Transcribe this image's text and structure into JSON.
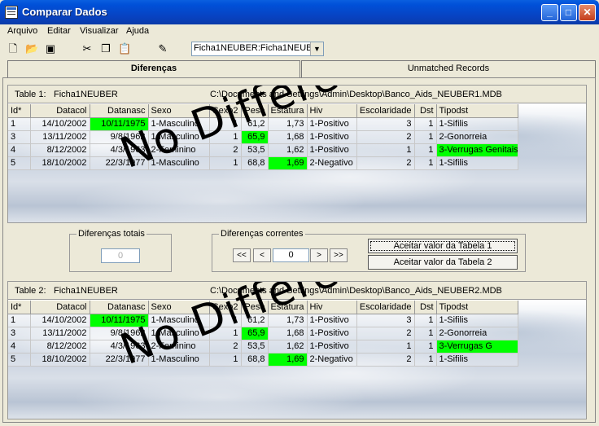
{
  "window": {
    "title": "Comparar Dados"
  },
  "menu": [
    "Arquivo",
    "Editar",
    "Visualizar",
    "Ajuda"
  ],
  "toolbar": {
    "icons": [
      "new-file-icon",
      "open-folder-icon",
      "export-icon",
      "cut-icon",
      "copy-icon",
      "paste-icon",
      "pencil-icon"
    ],
    "table_select": "Ficha1NEUBER:Ficha1NEUB"
  },
  "tabs": {
    "active": "Diferenças",
    "other": "Unmatched Records"
  },
  "columns": [
    "Id*",
    "Datacol",
    "Datanasc",
    "Sexo",
    "Sexo2",
    "Peso",
    "Estatura",
    "Hiv",
    "Escolaridade",
    "Dst",
    "Tipodst"
  ],
  "table1": {
    "label": "Table 1:",
    "name": "Ficha1NEUBER",
    "path": "C:\\Documents and Settings\\Admin\\Desktop\\Banco_Aids_NEUBER1.MDB",
    "rows": [
      [
        "1",
        "14/10/2002",
        "10/11/1975",
        "1-Masculino",
        "1",
        "61,2",
        "1,73",
        "1-Positivo",
        "3",
        "1",
        "1-Sifilis"
      ],
      [
        "3",
        "13/11/2002",
        "9/8/1962",
        "1-Masculino",
        "1",
        "65,9",
        "1,68",
        "1-Positivo",
        "2",
        "1",
        "2-Gonorreia"
      ],
      [
        "4",
        "8/12/2002",
        "4/3/1963",
        "2-Feminino",
        "2",
        "53,5",
        "1,62",
        "1-Positivo",
        "1",
        "1",
        "3-Verrugas Genitais"
      ],
      [
        "5",
        "18/10/2002",
        "22/3/1977",
        "1-Masculino",
        "1",
        "68,8",
        "1,69",
        "2-Negativo",
        "2",
        "1",
        "1-Sifilis"
      ]
    ]
  },
  "table2": {
    "label": "Table 2:",
    "name": "Ficha1NEUBER",
    "path": "C:\\Documents and Settings\\Admin\\Desktop\\Banco_Aids_NEUBER2.MDB",
    "rows": [
      [
        "1",
        "14/10/2002",
        "10/11/1975",
        "1-Masculino",
        "1",
        "61,2",
        "1,73",
        "1-Positivo",
        "3",
        "1",
        "1-Sifilis"
      ],
      [
        "3",
        "13/11/2002",
        "9/8/1962",
        "1-Masculino",
        "1",
        "65,9",
        "1,68",
        "1-Positivo",
        "2",
        "1",
        "2-Gonorreia"
      ],
      [
        "4",
        "8/12/2002",
        "4/3/1963",
        "2-Feminino",
        "2",
        "53,5",
        "1,62",
        "1-Positivo",
        "1",
        "1",
        "3-Verrugas G"
      ],
      [
        "5",
        "18/10/2002",
        "22/3/1977",
        "1-Masculino",
        "1",
        "68,8",
        "1,69",
        "2-Negativo",
        "2",
        "1",
        "1-Sifilis"
      ]
    ]
  },
  "highlighted_cells": [
    [
      0,
      2
    ],
    [
      1,
      5
    ],
    [
      2,
      10
    ],
    [
      3,
      6
    ]
  ],
  "highlight_color": "#00ff00",
  "watermark": "No Differences",
  "totals": {
    "label": "Diferenças totais",
    "value": "0"
  },
  "current": {
    "label": "Diferenças correntes",
    "value": "0",
    "first": "<<",
    "prev": "<",
    "next": ">",
    "last": ">>"
  },
  "buttons": {
    "accept1": "Aceitar valor da Tabela 1",
    "accept2": "Aceitar valor da Tabela 2"
  }
}
